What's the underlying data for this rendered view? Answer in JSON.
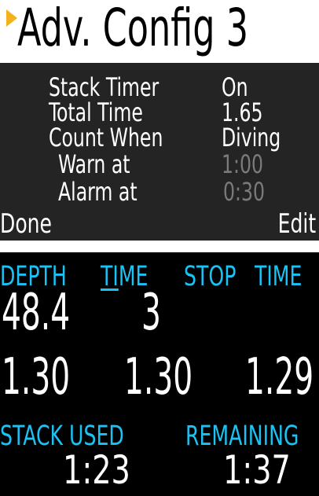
{
  "menu": {
    "title": "Adv. Config 3",
    "rows": [
      {
        "label": "Stack Timer",
        "value": "On",
        "dim": false
      },
      {
        "label": "Total Time",
        "value": "1.65",
        "dim": false
      },
      {
        "label": "Count When",
        "value": "Diving",
        "dim": false
      },
      {
        "label": "Warn at",
        "value": "1:00",
        "dim": true
      },
      {
        "label": "Alarm at",
        "value": "0:30",
        "dim": true
      }
    ],
    "softkeys": {
      "left": "Done",
      "right": "Edit"
    }
  },
  "dive": {
    "headers": {
      "depth": "DEPTH",
      "time_ti": "TI",
      "time_rest": "ME",
      "stop": "STOP",
      "time2": "TIME"
    },
    "depth": "48.4",
    "time": "3",
    "row2": [
      "1.30",
      "1.30",
      "1.29"
    ],
    "stack_headers": {
      "stack_used": "STACK USED",
      "remaining": "REMAINING"
    },
    "stack_used": "1:23",
    "remaining": "1:37"
  },
  "colors": {
    "accent": "#19c3f5",
    "arrow": "#f2b21c",
    "dim_text": "#7a7a7a"
  }
}
